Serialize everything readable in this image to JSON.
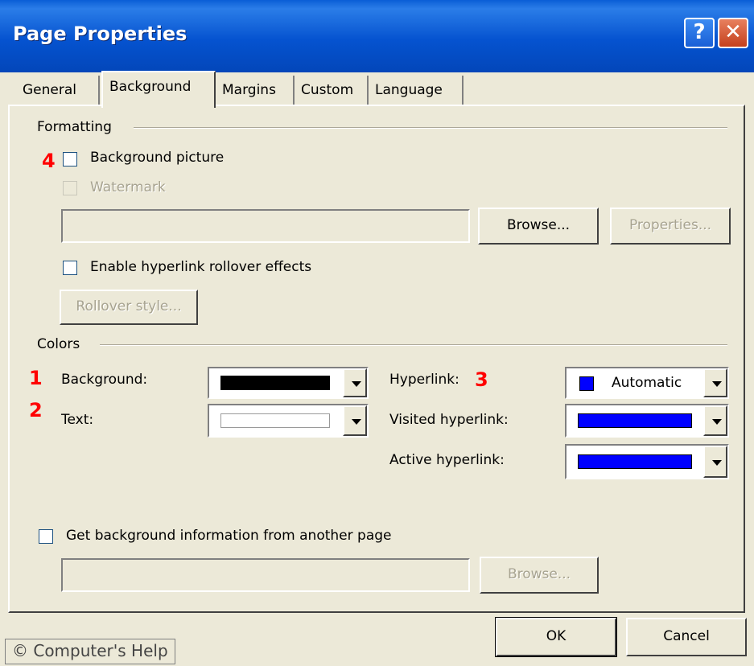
{
  "window": {
    "title": "Page Properties"
  },
  "tabs": [
    "General",
    "Background",
    "Margins",
    "Custom",
    "Language"
  ],
  "formatting": {
    "legend": "Formatting",
    "background_picture_label": "Background picture",
    "watermark_label": "Watermark",
    "browse_label": "Browse...",
    "properties_label": "Properties...",
    "rollover_label": "Enable hyperlink rollover effects",
    "rollover_style_label": "Rollover style..."
  },
  "colors": {
    "legend": "Colors",
    "background_label": "Background:",
    "background_color": "#000000",
    "text_label": "Text:",
    "text_color": "#ffffff",
    "hyperlink_label": "Hyperlink:",
    "hyperlink_value": "Automatic",
    "hyperlink_color": "#0000ff",
    "visited_label": "Visited hyperlink:",
    "visited_color": "#0000ff",
    "active_label": "Active hyperlink:",
    "active_color": "#0000ff"
  },
  "other_page": {
    "label": "Get background information from another page",
    "browse_label": "Browse..."
  },
  "buttons": {
    "ok": "OK",
    "cancel": "Cancel"
  },
  "markers": [
    "1",
    "2",
    "3",
    "4"
  ],
  "watermark_text": "© Computer's Help",
  "icons": {
    "help": "help-icon",
    "close": "close-icon"
  }
}
